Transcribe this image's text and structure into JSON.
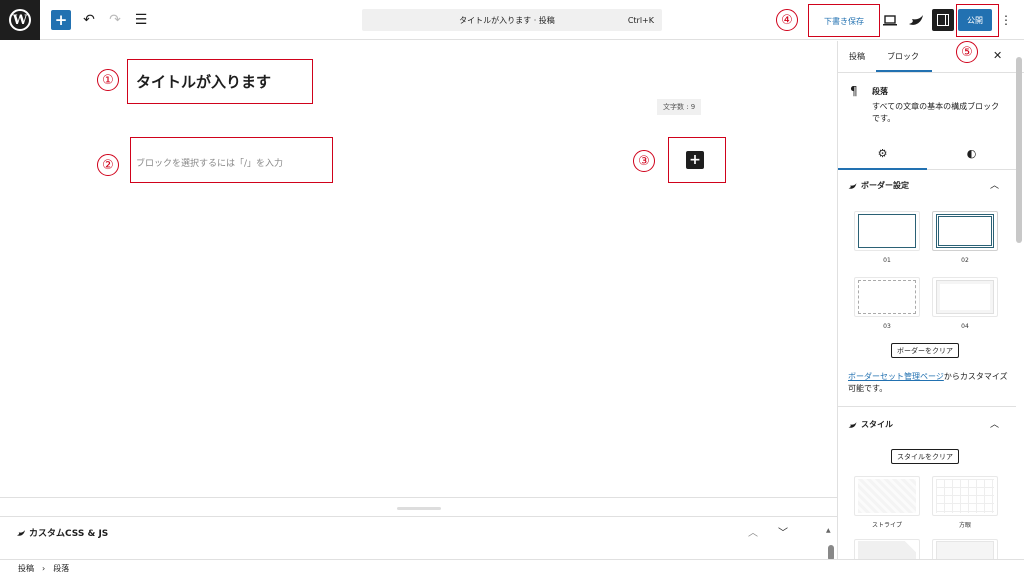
{
  "toolbar": {
    "logo_letter": "W",
    "add_icon": "+",
    "undo_icon": "↶",
    "redo_icon": "↷",
    "list_icon": "☰",
    "document_title": "タイトルが入ります · 投稿",
    "command_shortcut": "Ctrl+K",
    "save_draft_label": "下書き保存",
    "preview_icon": "laptop-icon",
    "publish_label": "公開",
    "more_icon": "⋮"
  },
  "editor": {
    "post_title": "タイトルが入ります",
    "char_count": "文字数 : 9",
    "paragraph_placeholder": "ブロックを選択するには「/」を入力",
    "inserter_icon": "+"
  },
  "annotations": {
    "n1": "①",
    "n2": "②",
    "n3": "③",
    "n4": "④",
    "n5": "⑤",
    "color": "#d0021b"
  },
  "metabox": {
    "title": "カスタムCSS & JS",
    "up_icon": "︿",
    "down_icon": "﹀",
    "scroll_icon": "▲"
  },
  "footer": {
    "crumb_root": "投稿",
    "separator": "›",
    "crumb_current": "段落"
  },
  "sidebar": {
    "tab_post": "投稿",
    "tab_block": "ブロック",
    "close_icon": "✕",
    "block_icon": "¶",
    "block_name": "段落",
    "block_description": "すべての文章の基本の構成ブロックです。",
    "settings_icon": "⚙",
    "styles_icon": "◐",
    "border_panel_title": "ボーダー設定",
    "panel_collapse_icon": "︿",
    "border_presets": [
      "01",
      "02",
      "03",
      "04"
    ],
    "clear_border_label": "ボーダーをクリア",
    "help_link": "ボーダーセット管理ページ",
    "help_text": "からカスタマイズ可能です。",
    "style_panel_title": "スタイル",
    "clear_style_label": "スタイルをクリア",
    "style_presets": [
      "ストライプ",
      "方眼"
    ]
  },
  "colors": {
    "accent": "#2271b1",
    "dark": "#1e1e1e"
  }
}
